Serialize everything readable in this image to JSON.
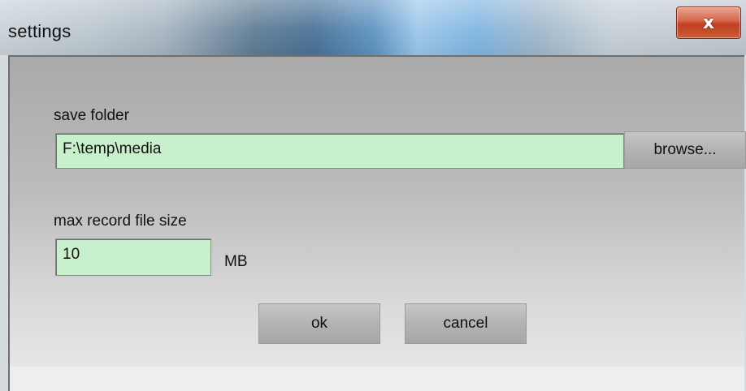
{
  "window": {
    "title": "settings",
    "close_label": "x"
  },
  "save_folder": {
    "label": "save folder",
    "value": "F:\\temp\\media",
    "browse_label": "browse..."
  },
  "max_size": {
    "label": "max record file size",
    "value": "10",
    "unit": "MB"
  },
  "actions": {
    "ok_label": "ok",
    "cancel_label": "cancel"
  },
  "colors": {
    "field_background": "#c9f0cc",
    "close_button": "#c1401f"
  }
}
